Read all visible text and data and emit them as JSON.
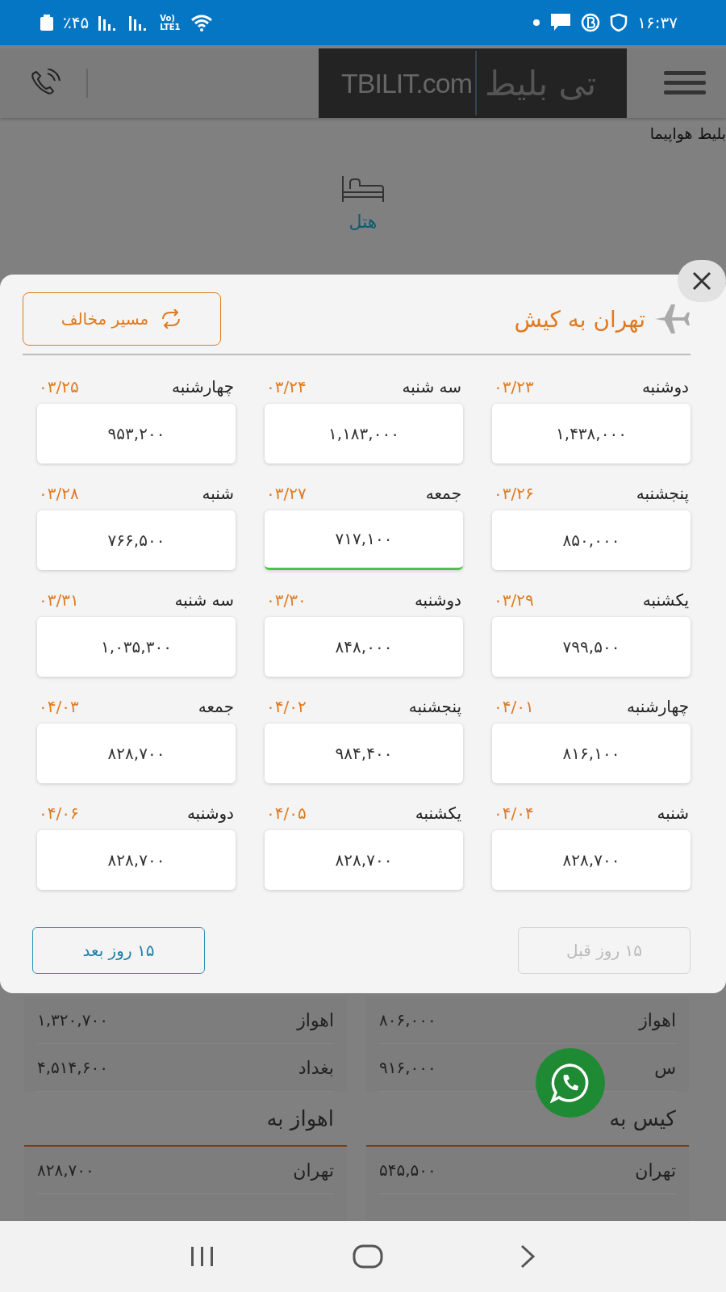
{
  "status_bar": {
    "battery": "٪۴۵",
    "network_top": "Vo)",
    "network_bottom": "LTE1",
    "time": "۱۶:۳۷"
  },
  "header": {
    "logo_latin": "TBILIT.com",
    "logo_persian": "تی بلیط"
  },
  "breadcrumb": "بلیط هواپیما",
  "service": {
    "label": "هتل"
  },
  "modal": {
    "title": "تهران به کیش",
    "reverse_button": "مسیر مخالف",
    "days": [
      {
        "day": "دوشنبه",
        "date": "۰۳/۲۳",
        "price": "۱,۴۳۸,۰۰۰",
        "selected": false
      },
      {
        "day": "سه شنبه",
        "date": "۰۳/۲۴",
        "price": "۱,۱۸۳,۰۰۰",
        "selected": false
      },
      {
        "day": "چهارشنبه",
        "date": "۰۳/۲۵",
        "price": "۹۵۳,۲۰۰",
        "selected": false
      },
      {
        "day": "پنجشنبه",
        "date": "۰۳/۲۶",
        "price": "۸۵۰,۰۰۰",
        "selected": false
      },
      {
        "day": "جمعه",
        "date": "۰۳/۲۷",
        "price": "۷۱۷,۱۰۰",
        "selected": true
      },
      {
        "day": "شنبه",
        "date": "۰۳/۲۸",
        "price": "۷۶۶,۵۰۰",
        "selected": false
      },
      {
        "day": "یکشنبه",
        "date": "۰۳/۲۹",
        "price": "۷۹۹,۵۰۰",
        "selected": false
      },
      {
        "day": "دوشنبه",
        "date": "۰۳/۳۰",
        "price": "۸۴۸,۰۰۰",
        "selected": false
      },
      {
        "day": "سه شنبه",
        "date": "۰۳/۳۱",
        "price": "۱,۰۳۵,۳۰۰",
        "selected": false
      },
      {
        "day": "چهارشنبه",
        "date": "۰۴/۰۱",
        "price": "۸۱۶,۱۰۰",
        "selected": false
      },
      {
        "day": "پنجشنبه",
        "date": "۰۴/۰۲",
        "price": "۹۸۴,۴۰۰",
        "selected": false
      },
      {
        "day": "جمعه",
        "date": "۰۴/۰۳",
        "price": "۸۲۸,۷۰۰",
        "selected": false
      },
      {
        "day": "شنبه",
        "date": "۰۴/۰۴",
        "price": "۸۲۸,۷۰۰",
        "selected": false
      },
      {
        "day": "یکشنبه",
        "date": "۰۴/۰۵",
        "price": "۸۲۸,۷۰۰",
        "selected": false
      },
      {
        "day": "دوشنبه",
        "date": "۰۴/۰۶",
        "price": "۸۲۸,۷۰۰",
        "selected": false
      }
    ],
    "next_button": "۱۵ روز بعد",
    "prev_button": {
      "label": "۱۵ روز قبل",
      "disabled": true
    }
  },
  "route_lists": [
    {
      "rows": [
        {
          "city": "اهواز",
          "price": "۸۰۶,۰۰۰"
        },
        {
          "city": "س",
          "price": "۹۱۶,۰۰۰"
        }
      ],
      "heading": "کیس به",
      "next_rows": [
        {
          "city": "تهران",
          "price": "۵۴۵,۵۰۰"
        }
      ]
    },
    {
      "rows": [
        {
          "city": "اهواز",
          "price": "۱,۳۲۰,۷۰۰"
        },
        {
          "city": "بغداد",
          "price": "۴,۵۱۴,۶۰۰"
        }
      ],
      "heading": "اهواز به",
      "next_rows": [
        {
          "city": "تهران",
          "price": "۸۲۸,۷۰۰"
        }
      ]
    }
  ]
}
